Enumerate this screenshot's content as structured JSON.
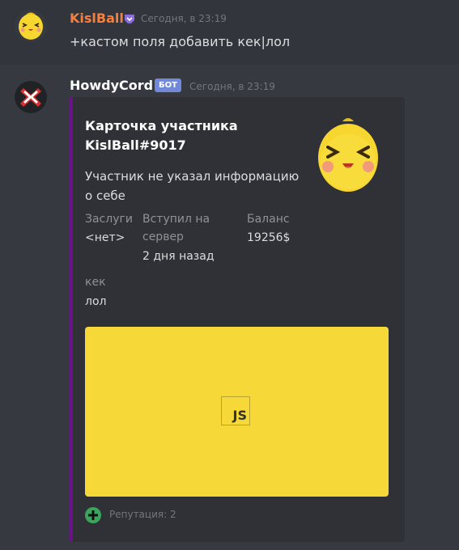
{
  "message_1": {
    "username": "KislBall",
    "username_color": "#f48040",
    "timestamp": "Сегодня, в 23:19",
    "badge_icon": "nitro-badge-icon",
    "text": "+кастом поля добавить кек|лол"
  },
  "message_2": {
    "username": "HowdyCord",
    "username_color": "#ffffff",
    "bot_tag": "БОТ",
    "timestamp": "Сегодня, в 23:19",
    "embed": {
      "accent_color": "#6b0f8a",
      "title_line1": "Карточка участника",
      "title_line2": "KislBall#9017",
      "description_line1": "Участник не указал информацию",
      "description_line2": "о себе",
      "fields": [
        {
          "name": "Заслуги",
          "value": "<нет>"
        },
        {
          "name_line1": "Вступил на",
          "name_line2": "сервер",
          "value": "2 дня назад"
        },
        {
          "name": "Баланс",
          "value": "19256$"
        },
        {
          "name": "кек",
          "value": "лол"
        }
      ],
      "image_label": "JS",
      "image_color": "#f6d838",
      "footer_icon": "plus-circle-icon",
      "footer_text": "Репутация: 2"
    }
  }
}
